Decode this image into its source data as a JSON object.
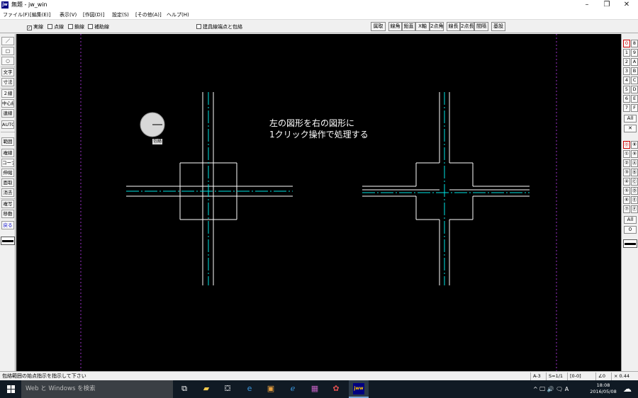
{
  "window": {
    "app_icon": "jw",
    "title": "無題 - jw_win",
    "controls": [
      "–",
      "❐",
      "✕"
    ]
  },
  "menu": [
    "ファイル(F)",
    "[編集(E)]",
    "表示(V)",
    "[作図(D)]",
    "設定(S)",
    "[その他(A)]",
    "ヘルプ(H)"
  ],
  "control_bar": {
    "checks": [
      {
        "label": "実線",
        "checked": true
      },
      {
        "label": "点線",
        "checked": false
      },
      {
        "label": "鎖線",
        "checked": false
      },
      {
        "label": "補助線",
        "checked": false
      }
    ],
    "option": {
      "label": "建具線端点と包絡",
      "checked": false
    },
    "buttons": [
      "属取",
      "線角",
      "鉛直",
      "X軸",
      "2点角",
      "線長",
      "2点長",
      "間隔",
      "基設"
    ]
  },
  "left_tools": [
    "／",
    "□",
    "○",
    "文字",
    "寸法",
    "２線",
    "中心線",
    "連線",
    "AUTO",
    "範囲",
    "複線",
    "コーナー",
    "伸縮",
    "面取",
    "消去",
    "複写",
    "移動",
    "戻る"
  ],
  "right_layers": {
    "group_numbers": [
      "0",
      "1",
      "2",
      "3",
      "4",
      "5",
      "6",
      "7"
    ],
    "group_letters": [
      "8",
      "9",
      "A",
      "B",
      "C",
      "D",
      "E",
      "F"
    ],
    "group_all": "All",
    "group_x": "✕",
    "layer_numbers": [
      "⓪",
      "①",
      "②",
      "③",
      "④",
      "⑤",
      "⑥",
      "⑦"
    ],
    "layer_letters": [
      "⑧",
      "⑨",
      "Ⓐ",
      "Ⓑ",
      "Ⓒ",
      "Ⓓ",
      "Ⓔ",
      "Ⓕ"
    ],
    "layer_all": "All",
    "layer_zero": "0"
  },
  "canvas": {
    "note_line1": "左の図形を右の図形に",
    "note_line2": "1クリック操作で処理する",
    "cursor_label": "包絡",
    "colors": {
      "background": "#000000",
      "wall": "#ffffff",
      "center": "#00e5e5",
      "guide": "#9b30c8"
    }
  },
  "status": {
    "message": "包絡範囲の始点指示を指示して下さい",
    "paper": "A-3",
    "scale": "S=1/1",
    "layer": "[0-0]",
    "angle": "∠0",
    "ratio": "× 0.44"
  },
  "taskbar": {
    "search_placeholder": "Web と Windows を検索",
    "tray_text": "^ 🖵 🔊 🗨 A",
    "time": "18:08",
    "date": "2016/05/08"
  }
}
